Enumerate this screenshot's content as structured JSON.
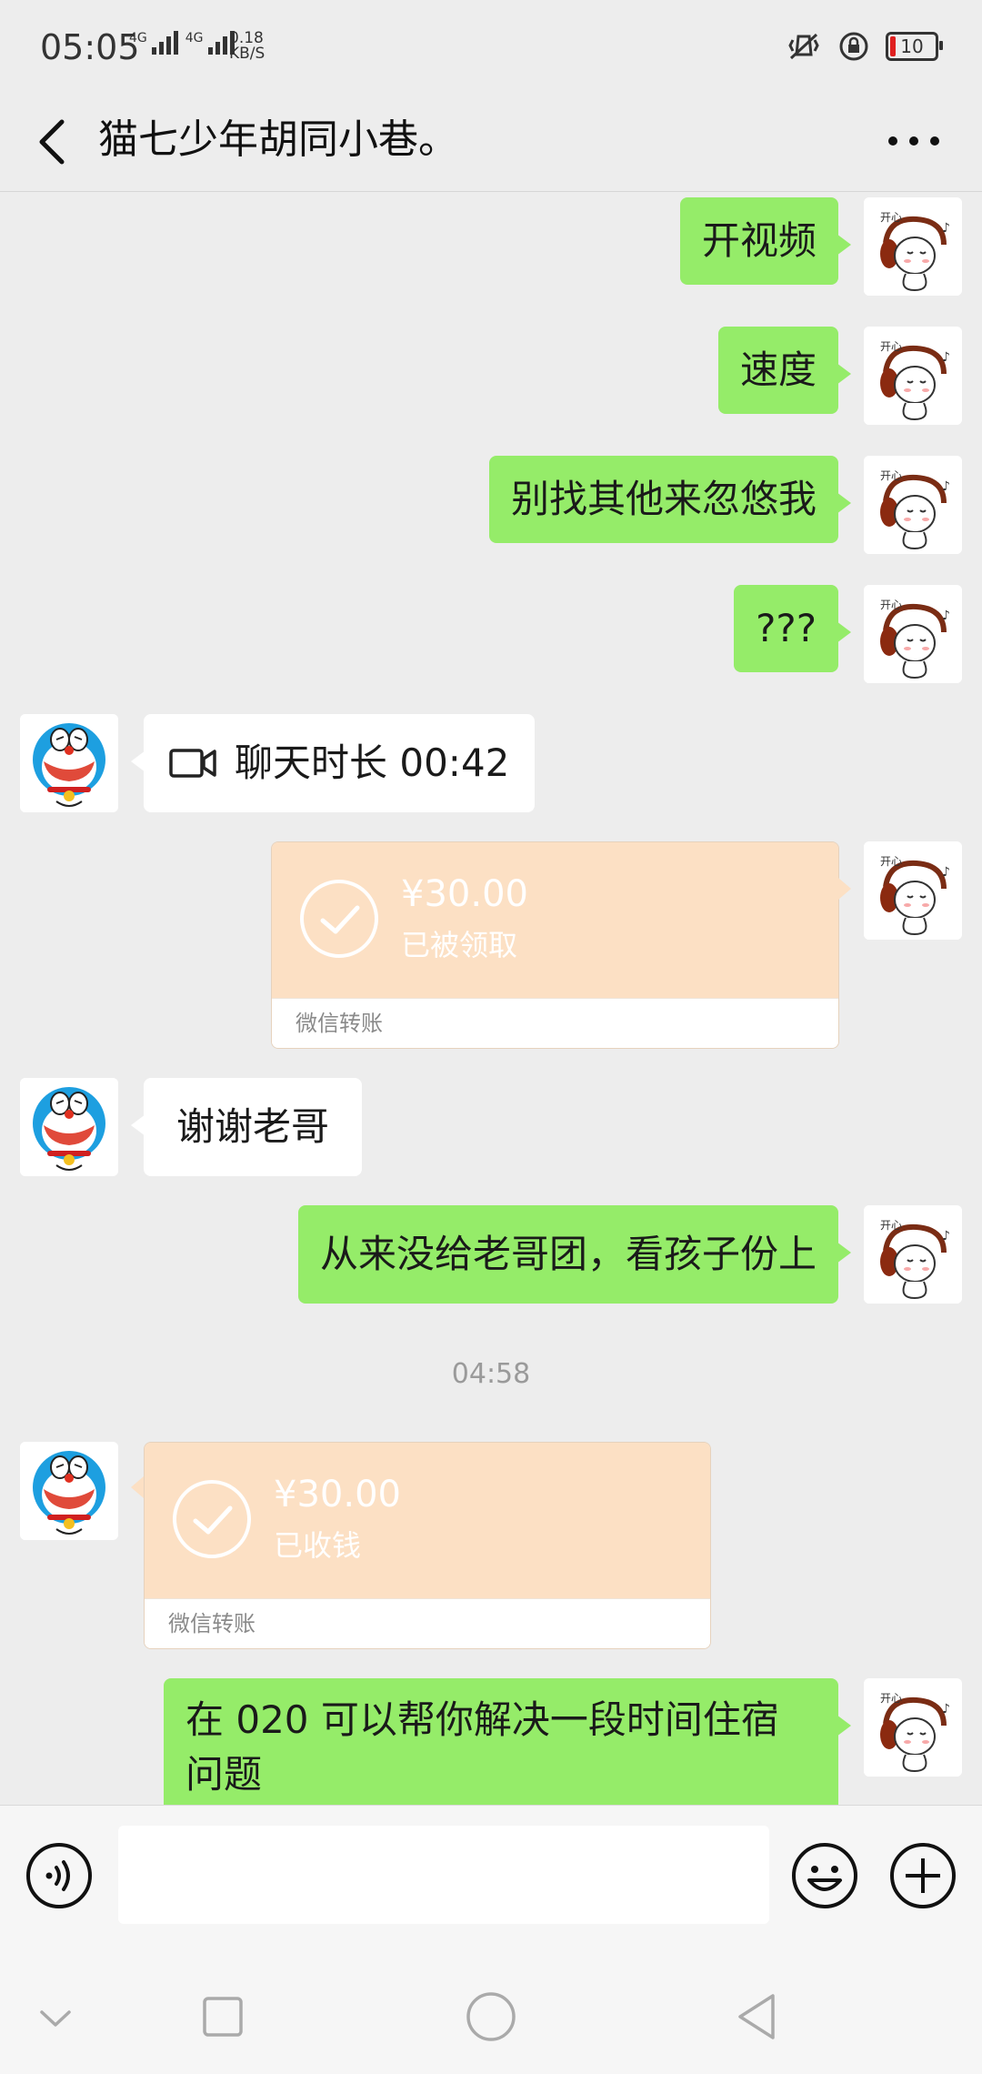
{
  "status_bar": {
    "time": "05:05",
    "network_1": "4G",
    "network_2": "4G",
    "speed_value": "0.18",
    "speed_unit": "KB/S",
    "battery": "10"
  },
  "header": {
    "title": "猫七少年胡同小巷。"
  },
  "messages": [
    {
      "side": "out",
      "type": "text",
      "text": "开视频"
    },
    {
      "side": "out",
      "type": "text",
      "text": "速度"
    },
    {
      "side": "out",
      "type": "text",
      "text": "别找其他来忽悠我"
    },
    {
      "side": "out",
      "type": "text",
      "text": "???"
    },
    {
      "side": "in",
      "type": "video_call",
      "text": "聊天时长 00:42"
    },
    {
      "side": "out",
      "type": "transfer",
      "amount": "¥30.00",
      "status": "已被领取",
      "label": "微信转账"
    },
    {
      "side": "in",
      "type": "text",
      "text": "谢谢老哥"
    },
    {
      "side": "out",
      "type": "text",
      "text": "从来没给老哥团，看孩子份上"
    },
    {
      "type": "timestamp",
      "text": "04:58"
    },
    {
      "side": "in",
      "type": "transfer",
      "amount": "¥30.00",
      "status": "已收钱",
      "label": "微信转账"
    },
    {
      "side": "out",
      "type": "text",
      "text_line1": "在 020 可以帮你解决一段时间住宿",
      "text_line2": "问题"
    }
  ],
  "input_bar": {
    "message_value": ""
  },
  "colors": {
    "outgoing_bubble": "#95ec69",
    "incoming_bubble": "#ffffff",
    "transfer_bg": "#fce0c4",
    "chat_bg": "#ededed"
  },
  "icons": [
    "back-arrow-icon",
    "more-dots-icon",
    "video-call-icon",
    "check-circle-icon",
    "voice-icon",
    "emoji-icon",
    "plus-icon",
    "nav-down-icon",
    "nav-square-icon",
    "nav-home-icon",
    "nav-back-icon"
  ]
}
